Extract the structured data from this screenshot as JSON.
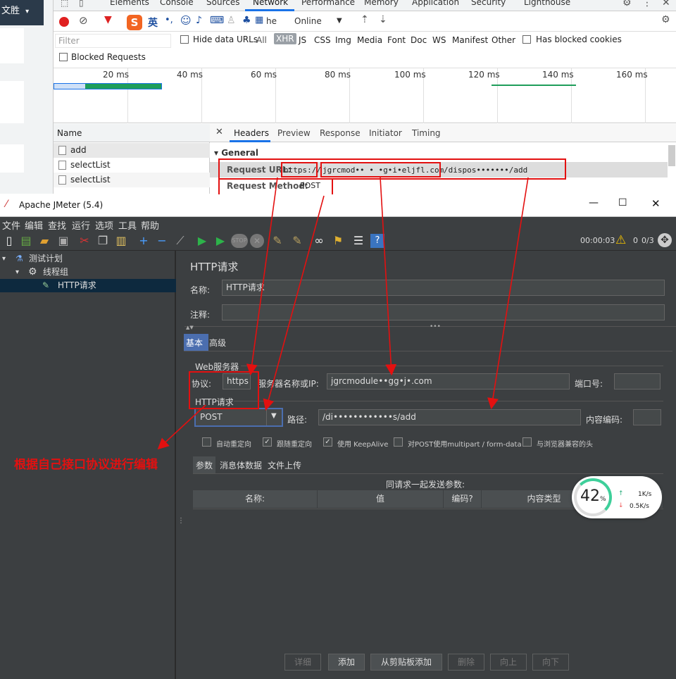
{
  "browser_left": {
    "title": "文胜",
    "caret": "▾"
  },
  "devtools": {
    "tabs": [
      "Elements",
      "Console",
      "Sources",
      "Network",
      "Performance",
      "Memory",
      "Application",
      "Security",
      "Lighthouse"
    ],
    "active_tab": "Network",
    "toolbar": {
      "throttle_partial": "he",
      "throttle": "Online",
      "throttle_caret": "▼"
    },
    "ime": {
      "logo": "S",
      "lang": "英",
      "punct": "•,"
    },
    "filter": {
      "placeholder": "Filter",
      "hide_data_urls": "Hide data URLs",
      "types": [
        "All",
        "XHR",
        "JS",
        "CSS",
        "Img",
        "Media",
        "Font",
        "Doc",
        "WS",
        "Manifest",
        "Other"
      ],
      "active_type": "XHR",
      "has_blocked_cookies": "Has blocked cookies",
      "blocked_requests": "Blocked Requests"
    },
    "timeline_ticks": [
      "20 ms",
      "40 ms",
      "60 ms",
      "80 ms",
      "100 ms",
      "120 ms",
      "140 ms",
      "160 ms"
    ],
    "name_header": "Name",
    "requests": [
      "add",
      "selectList",
      "selectList"
    ],
    "detail_tabs": [
      "Headers",
      "Preview",
      "Response",
      "Initiator",
      "Timing"
    ],
    "active_detail_tab": "Headers",
    "general_label": "▾ General",
    "request_url_label": "Request URL:",
    "request_url_scheme": "https://",
    "request_url_host": "jgrcmod•• • •g•i•eljfl.com",
    "request_url_path": "/dispos•••••••/add",
    "request_method_label": "Request Method:",
    "request_method": "POST"
  },
  "jmeter": {
    "title": "Apache JMeter (5.4)",
    "window_controls": {
      "min": "—",
      "max": "☐",
      "close": "✕"
    },
    "menu": [
      "文件",
      "编辑",
      "查找",
      "运行",
      "选项",
      "工具",
      "帮助"
    ],
    "timer": "00:00:03",
    "warnings": "0",
    "threads": "0/3",
    "tree": [
      {
        "label": "测试计划",
        "level": 0
      },
      {
        "label": "线程组",
        "level": 1
      },
      {
        "label": "HTTP请求",
        "level": 2
      }
    ],
    "panel_title": "HTTP请求",
    "name_label": "名称:",
    "name_value": "HTTP请求",
    "comment_label": "注释:",
    "comment_value": "",
    "tabs": [
      "基本",
      "高级"
    ],
    "web_server_section": "Web服务器",
    "protocol_label": "协议:",
    "protocol_value": "https",
    "server_label": "服务器名称或IP:",
    "server_value": "jgrcmodule••gg•j•.com",
    "port_label": "端口号:",
    "port_value": "",
    "http_section": "HTTP请求",
    "method_value": "POST",
    "path_label": "路径:",
    "path_value": "/di••••••••••••s/add",
    "encoding_label": "内容编码:",
    "encoding_value": "",
    "options": [
      {
        "label": "自动重定向",
        "checked": false
      },
      {
        "label": "跟随重定向",
        "checked": true
      },
      {
        "label": "使用 KeepAlive",
        "checked": true
      },
      {
        "label": "对POST使用multipart / form-data",
        "checked": false
      },
      {
        "label": "与浏览器兼容的头",
        "checked": false
      }
    ],
    "sub_tabs": [
      "参数",
      "消息体数据",
      "文件上传"
    ],
    "params_caption": "同请求一起发送参数:",
    "params_columns": [
      "名称:",
      "值",
      "编码?",
      "内容类型"
    ],
    "buttons": [
      {
        "label": "详细",
        "enabled": false
      },
      {
        "label": "添加",
        "enabled": true
      },
      {
        "label": "从剪贴板添加",
        "enabled": true
      },
      {
        "label": "删除",
        "enabled": false
      },
      {
        "label": "向上",
        "enabled": false
      },
      {
        "label": "向下",
        "enabled": false
      }
    ]
  },
  "speed_widget": {
    "percent": "42",
    "percent_unit": "%",
    "up": "1K/s",
    "down": "0.5K/s"
  },
  "annotation": "根据自己接口协议进行编辑",
  "colors": {
    "accent": "#1a73e8",
    "annotation_red": "#e31010",
    "jmeter_bg": "#3c3f41"
  }
}
